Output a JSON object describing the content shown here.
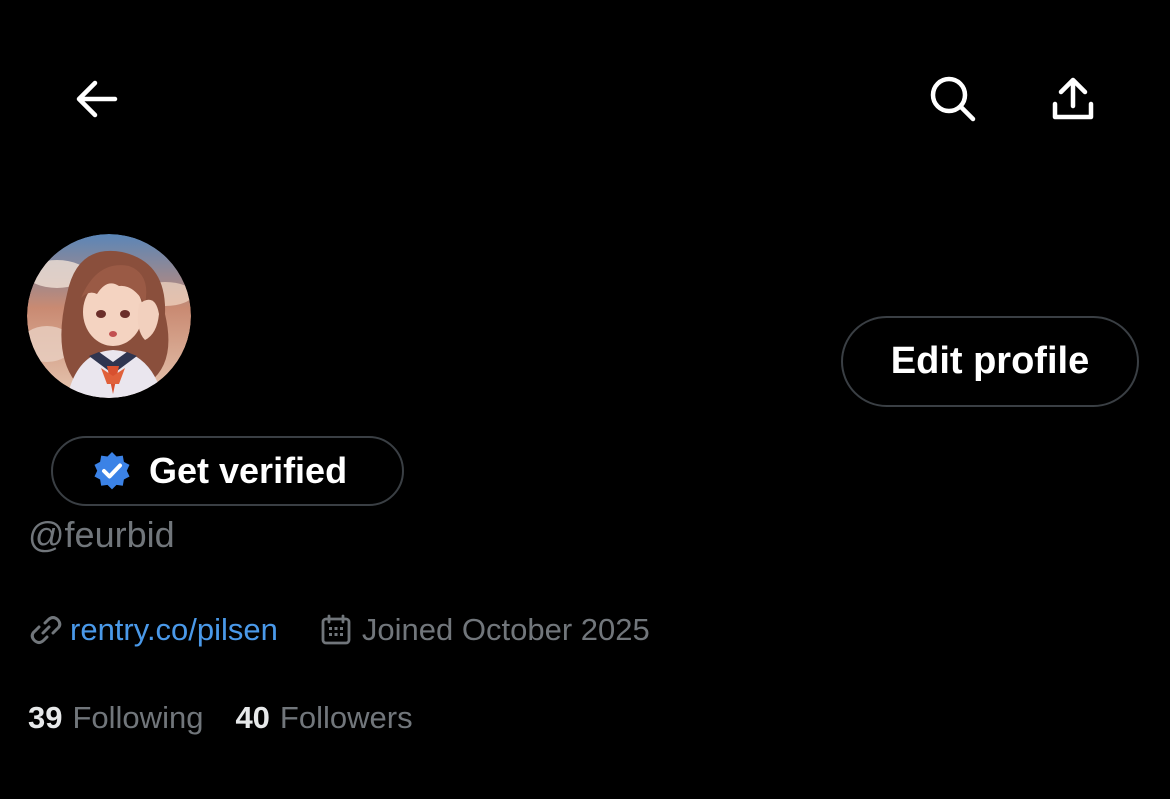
{
  "topbar": {
    "back_icon": "arrow-left-icon",
    "search_icon": "search-icon",
    "share_icon": "share-upload-icon"
  },
  "profile": {
    "avatar_icon": "anime-girl-avatar",
    "edit_profile_label": "Edit profile",
    "get_verified_label": "Get verified",
    "handle": "@feurbid",
    "website": "rentry.co/pilsen",
    "joined": "Joined October 2025"
  },
  "stats": {
    "following_count": "39",
    "following_label": "Following",
    "followers_count": "40",
    "followers_label": "Followers"
  },
  "colors": {
    "background": "#000000",
    "link": "#4a99e9",
    "muted": "#71767b",
    "verified_badge": "#3b82e6",
    "button_border": "#3a3f44"
  }
}
